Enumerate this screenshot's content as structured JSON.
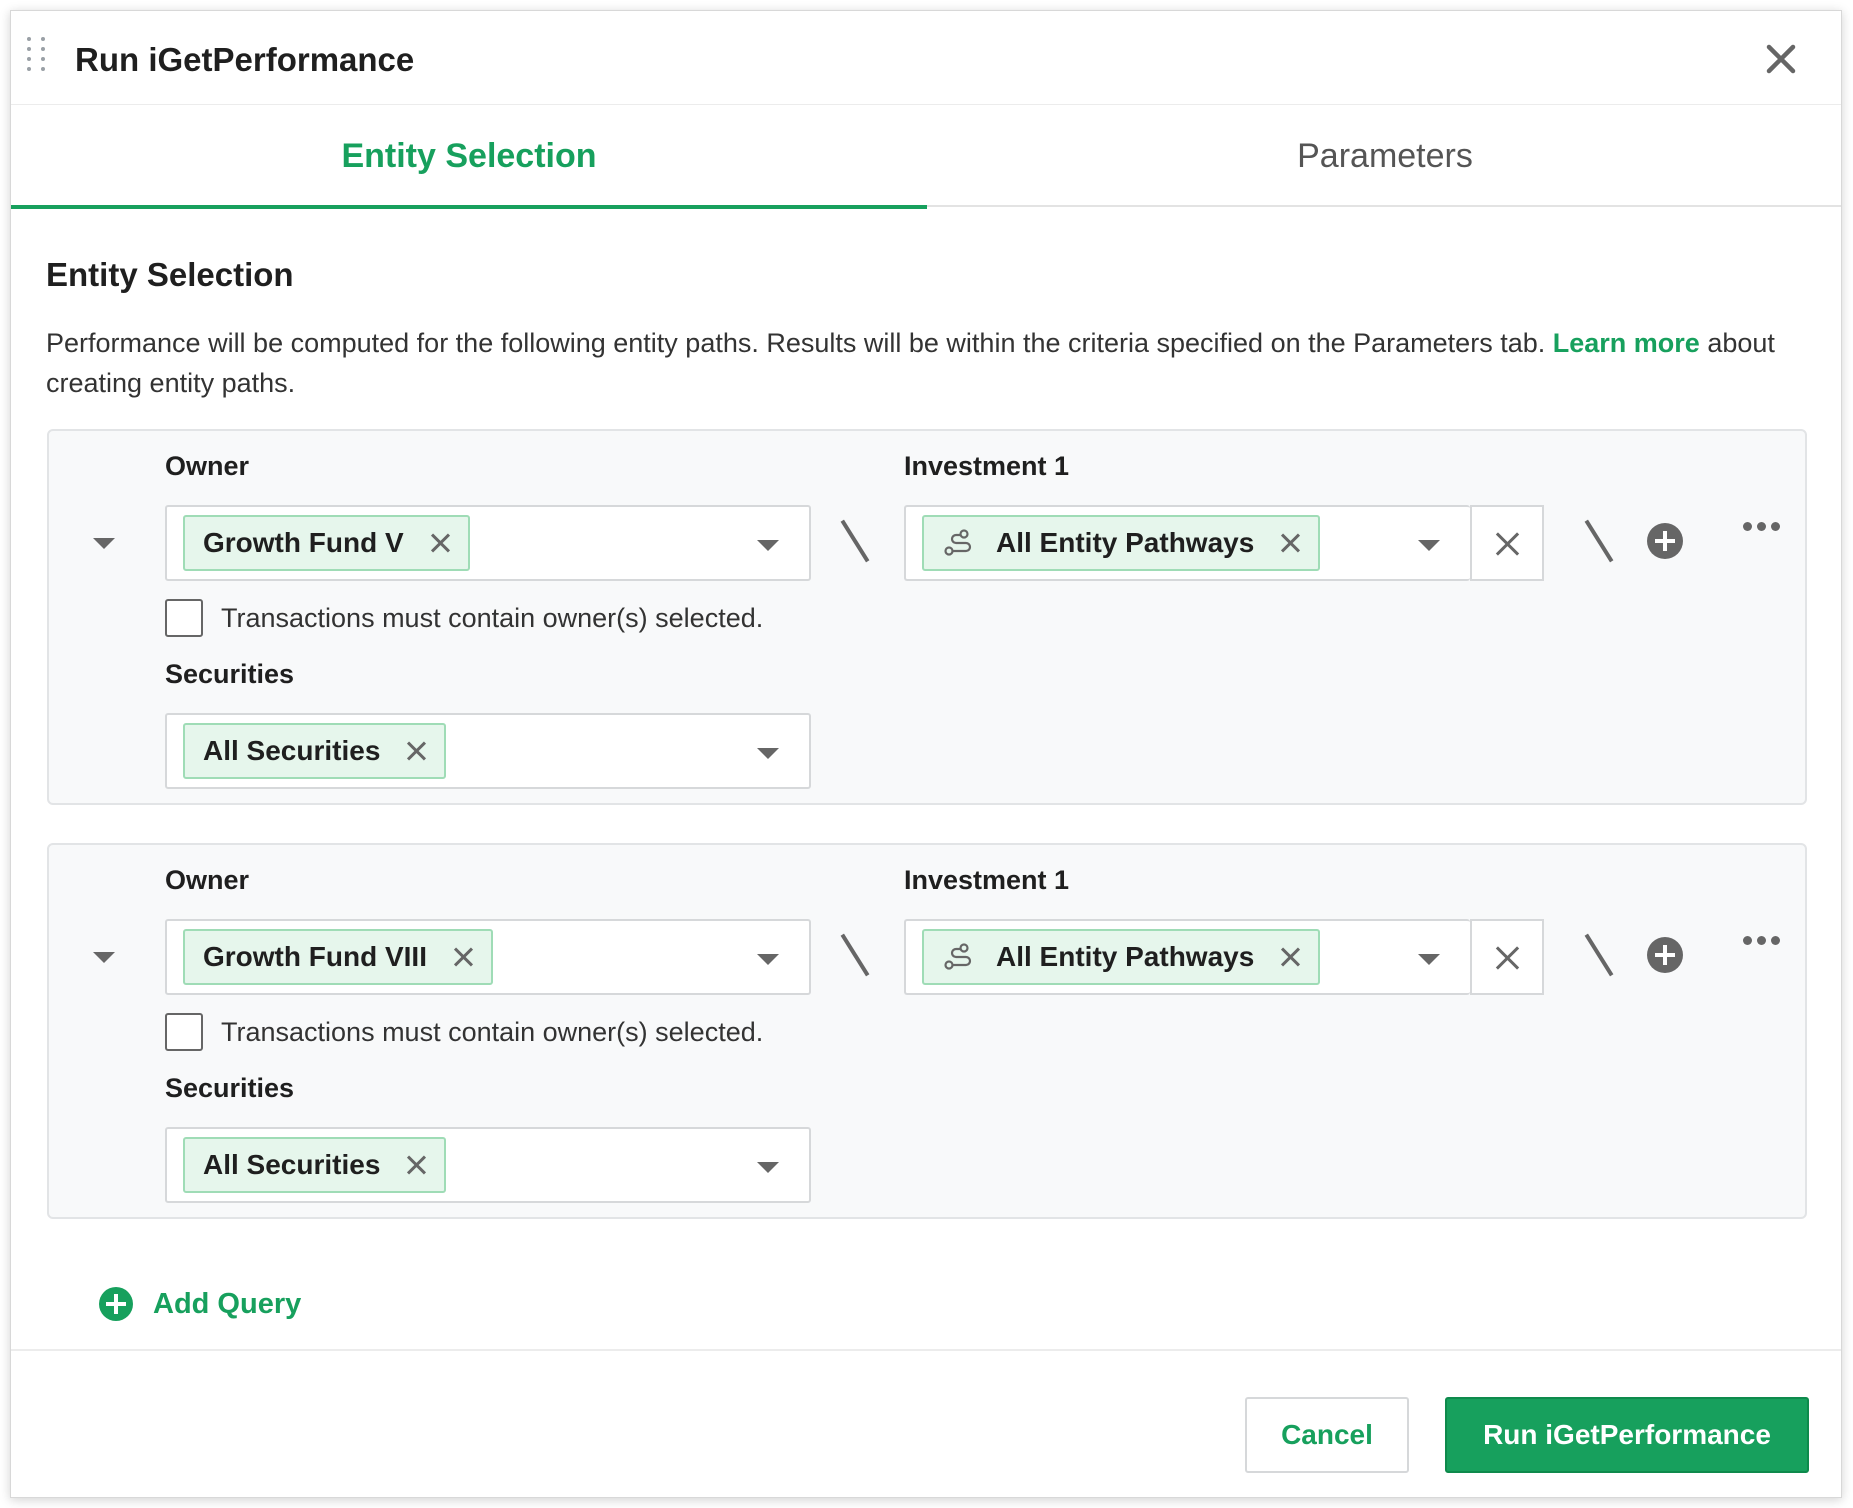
{
  "dialog": {
    "title": "Run iGetPerformance"
  },
  "tabs": [
    {
      "label": "Entity Selection",
      "active": true
    },
    {
      "label": "Parameters",
      "active": false
    }
  ],
  "section": {
    "title": "Entity Selection",
    "description": "Performance will be computed for the following entity paths. Results will be within the criteria specified on the Parameters tab.",
    "link_text": "Learn more",
    "description_tail": "about creating entity paths."
  },
  "queries": [
    {
      "owner_label": "Owner",
      "owner_tag": "Growth Fund V",
      "investment_label": "Investment 1",
      "investment_tag": "All Entity Pathways",
      "checkbox_label": "Transactions must contain owner(s) selected.",
      "checkbox_checked": false,
      "securities_label": "Securities",
      "securities_tag": "All Securities"
    },
    {
      "owner_label": "Owner",
      "owner_tag": "Growth Fund VIII",
      "investment_label": "Investment 1",
      "investment_tag": "All Entity Pathways",
      "checkbox_label": "Transactions must contain owner(s) selected.",
      "checkbox_checked": false,
      "securities_label": "Securities",
      "securities_tag": "All Securities"
    }
  ],
  "add_query_label": "Add Query",
  "footer": {
    "cancel_label": "Cancel",
    "run_label": "Run iGetPerformance"
  },
  "colors": {
    "accent": "#17a05d",
    "tag_bg": "#e6f6ec",
    "card_bg": "#f8f9fa"
  },
  "icons": {
    "drag": "drag-handle-icon",
    "close": "close-icon",
    "path": "entity-pathway-icon",
    "add": "plus-circle-icon",
    "more": "more-horizontal-icon"
  }
}
